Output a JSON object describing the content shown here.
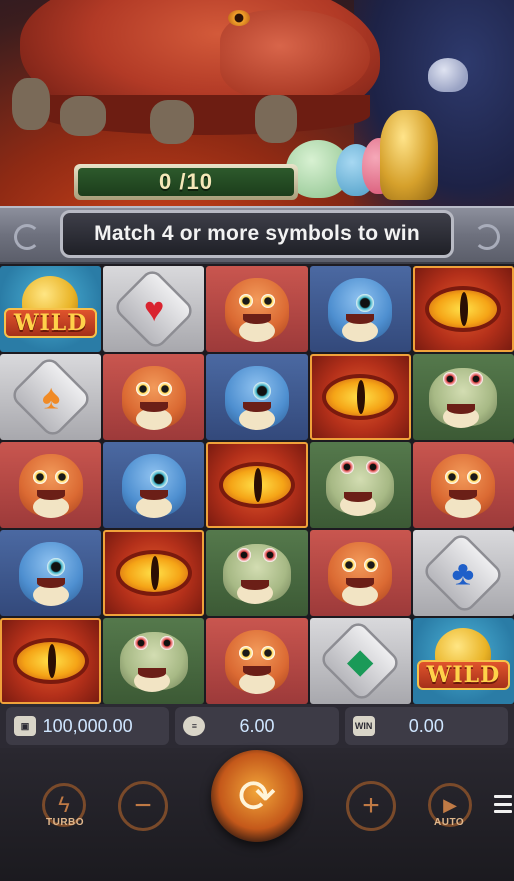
{
  "progress": {
    "text": "0 /10"
  },
  "banner": {
    "text": "Match 4 or more symbols to win"
  },
  "grid": [
    [
      "wild",
      "heart",
      "orange-dragon",
      "blue-dragon",
      "dragon-eye"
    ],
    [
      "spade",
      "orange-dragon",
      "blue-dragon",
      "dragon-eye",
      "frog"
    ],
    [
      "orange-dragon",
      "blue-dragon",
      "dragon-eye",
      "frog",
      "orange-dragon"
    ],
    [
      "blue-dragon",
      "dragon-eye",
      "frog",
      "orange-dragon",
      "club"
    ],
    [
      "dragon-eye",
      "frog",
      "orange-dragon",
      "diamond",
      "wild"
    ]
  ],
  "wild_label": "WILD",
  "info": {
    "balance": "100,000.00",
    "bet": "6.00",
    "win": "0.00",
    "win_icon_label": "WIN"
  },
  "controls": {
    "turbo_label": "TURBO",
    "auto_label": "AUTO"
  },
  "icons": {
    "wallet": "wallet-icon",
    "coins": "coins-icon",
    "win": "win-icon",
    "turbo": "lightning-icon",
    "minus": "minus-icon",
    "spin": "refresh-icon",
    "plus": "plus-icon",
    "auto": "play-icon",
    "menu": "hamburger-menu-icon"
  },
  "colors": {
    "progress_green": "#2d5a2c",
    "spin_orange": "#c4581a",
    "control_brown": "#7a4a2a",
    "info_text": "#cfe6ff"
  }
}
